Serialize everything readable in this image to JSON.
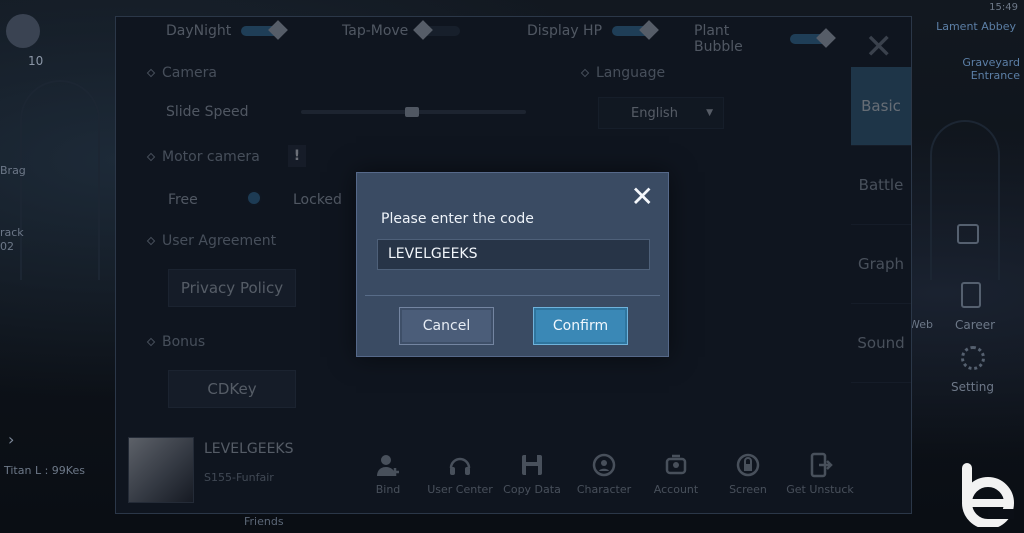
{
  "toggles": [
    {
      "label": "DayNight",
      "on": true
    },
    {
      "label": "Tap-Move",
      "on": false
    },
    {
      "label": "Display HP",
      "on": true
    },
    {
      "label": "Plant Bubble",
      "on": true
    }
  ],
  "settings": {
    "camera_label": "Camera",
    "slide_speed_label": "Slide Speed",
    "slide_speed_value": 0.48,
    "motor_camera_label": "Motor camera",
    "free_label": "Free",
    "locked_label": "Locked",
    "user_agreement_label": "User Agreement",
    "privacy_policy_label": "Privacy Policy",
    "bonus_label": "Bonus",
    "cdkey_label": "CDKey",
    "language_label": "Language",
    "language_value": "English"
  },
  "tabs": [
    {
      "label": "Basic",
      "active": true
    },
    {
      "label": "Battle",
      "active": false
    },
    {
      "label": "Graph",
      "active": false
    },
    {
      "label": "Sound",
      "active": false
    }
  ],
  "profile": {
    "name": "LEVELGEEKS",
    "server": "S155-Funfair"
  },
  "actions": [
    {
      "label": "Bind",
      "icon": "person-add-icon"
    },
    {
      "label": "User Center",
      "icon": "headset-icon"
    },
    {
      "label": "Copy Data",
      "icon": "floppy-disk-icon"
    },
    {
      "label": "Character",
      "icon": "character-swap-icon"
    },
    {
      "label": "Account",
      "icon": "account-switch-icon"
    },
    {
      "label": "Screen",
      "icon": "screen-lock-icon"
    },
    {
      "label": "Get Unstuck",
      "icon": "phone-exit-icon"
    }
  ],
  "modal": {
    "title": "Please enter the code",
    "code_value": "LEVELGEEKS",
    "cancel_label": "Cancel",
    "confirm_label": "Confirm"
  },
  "hud": {
    "left_level": "10",
    "left_ltext": "Brag",
    "left_track": "rack",
    "left_num": "02",
    "left_bottom": "Titan L : 99Kes",
    "right_time": "15:49",
    "right_top": "Lament Abbey",
    "right_mid": "Graveyard Entrance",
    "right_career": "Career",
    "right_setting": "Setting",
    "right_side": "Web",
    "bottom_friends": "Friends"
  },
  "colors": {
    "panel_bg": "#1b2431",
    "modal_bg": "#3a4b63",
    "confirm_bg": "#3a88b6",
    "tab_active": "#3d6a8c"
  }
}
